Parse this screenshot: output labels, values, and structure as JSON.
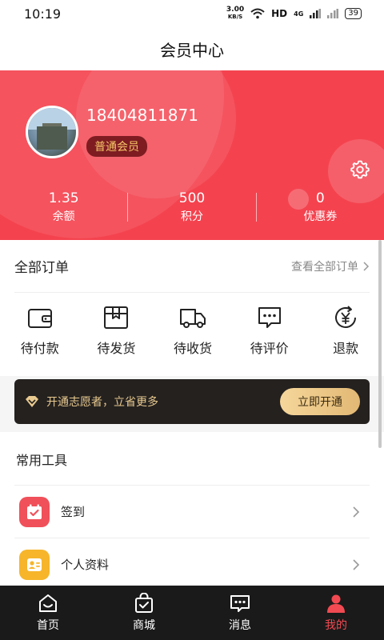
{
  "status_bar": {
    "time": "10:19",
    "speed_value": "3.00",
    "speed_unit": "KB/S",
    "network": "HD",
    "signal": "4G",
    "battery": "39"
  },
  "header": {
    "title": "会员中心"
  },
  "profile": {
    "phone": "18404811871",
    "member_level": "普通会员",
    "stats": [
      {
        "value": "1.35",
        "label": "余额"
      },
      {
        "value": "500",
        "label": "积分"
      },
      {
        "value": "0",
        "label": "优惠券"
      }
    ]
  },
  "orders": {
    "title": "全部订单",
    "view_all": "查看全部订单",
    "items": [
      {
        "label": "待付款",
        "icon": "wallet-icon"
      },
      {
        "label": "待发货",
        "icon": "package-icon"
      },
      {
        "label": "待收货",
        "icon": "truck-icon"
      },
      {
        "label": "待评价",
        "icon": "comment-icon"
      },
      {
        "label": "退款",
        "icon": "refund-icon"
      }
    ]
  },
  "vip": {
    "text": "开通志愿者，立省更多",
    "button": "立即开通"
  },
  "tools": {
    "title": "常用工具",
    "items": [
      {
        "label": "签到",
        "icon": "checkin-icon",
        "color": "#f0505a"
      },
      {
        "label": "个人资料",
        "icon": "profile-card-icon",
        "color": "#f6b52b"
      }
    ]
  },
  "tabbar": {
    "items": [
      {
        "label": "首页",
        "icon": "home-icon"
      },
      {
        "label": "商城",
        "icon": "shop-bag-icon"
      },
      {
        "label": "消息",
        "icon": "message-icon"
      },
      {
        "label": "我的",
        "icon": "user-icon"
      }
    ],
    "active_color": "#f24a52"
  },
  "colors": {
    "brand": "#f4434f",
    "badge_bg": "#7e1c22",
    "badge_text": "#f6c667"
  }
}
